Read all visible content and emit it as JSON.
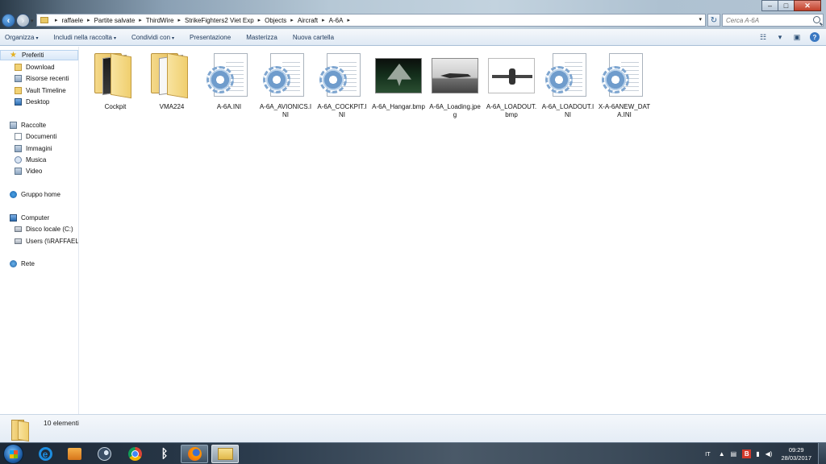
{
  "window": {
    "controls": {
      "minimize": "–",
      "maximize": "□",
      "close": "✕"
    }
  },
  "address_bar": {
    "breadcrumbs": [
      "raffaele",
      "Partite salvate",
      "ThirdWire",
      "StrikeFighters2 Viet Exp",
      "Objects",
      "Aircraft",
      "A-6A"
    ]
  },
  "search": {
    "placeholder": "Cerca A-6A"
  },
  "toolbar": {
    "items": [
      {
        "label": "Organizza",
        "has_menu": true
      },
      {
        "label": "Includi nella raccolta",
        "has_menu": true
      },
      {
        "label": "Condividi con",
        "has_menu": true
      },
      {
        "label": "Presentazione",
        "has_menu": false
      },
      {
        "label": "Masterizza",
        "has_menu": false
      },
      {
        "label": "Nuova cartella",
        "has_menu": false
      }
    ],
    "view_icon": "view-options-icon",
    "preview_icon": "preview-pane-icon",
    "help_icon": "help-icon"
  },
  "sidebar": {
    "groups": [
      {
        "label": "Preferiti",
        "icon": "star-icon",
        "items": [
          {
            "label": "Download",
            "icon": "download-folder-icon"
          },
          {
            "label": "Risorse recenti",
            "icon": "recent-places-icon"
          },
          {
            "label": "Vault Timeline",
            "icon": "folder-icon"
          },
          {
            "label": "Desktop",
            "icon": "desktop-icon"
          }
        ]
      },
      {
        "label": "Raccolte",
        "icon": "libraries-icon",
        "items": [
          {
            "label": "Documenti",
            "icon": "documents-icon"
          },
          {
            "label": "Immagini",
            "icon": "pictures-icon"
          },
          {
            "label": "Musica",
            "icon": "music-icon"
          },
          {
            "label": "Video",
            "icon": "video-icon"
          }
        ]
      },
      {
        "label": "Gruppo home",
        "icon": "homegroup-icon",
        "items": []
      },
      {
        "label": "Computer",
        "icon": "computer-icon",
        "items": [
          {
            "label": "Disco locale (C:)",
            "icon": "drive-icon"
          },
          {
            "label": "Users (\\\\RAFFAELE",
            "icon": "network-drive-icon"
          }
        ]
      },
      {
        "label": "Rete",
        "icon": "network-icon",
        "items": []
      }
    ]
  },
  "files": [
    {
      "name": "Cockpit",
      "type": "folder",
      "icon": "folder-icon",
      "variant": "dark"
    },
    {
      "name": "VMA224",
      "type": "folder",
      "icon": "folder-icon",
      "variant": "light"
    },
    {
      "name": "A-6A.INI",
      "type": "ini",
      "icon": "config-file-icon"
    },
    {
      "name": "A-6A_AVIONICS.INI",
      "type": "ini",
      "icon": "config-file-icon"
    },
    {
      "name": "A-6A_COCKPIT.INI",
      "type": "ini",
      "icon": "config-file-icon"
    },
    {
      "name": "A-6A_Hangar.bmp",
      "type": "image",
      "icon": "image-thumbnail",
      "variant": "hangar"
    },
    {
      "name": "A-6A_Loading.jpeg",
      "type": "image",
      "icon": "image-thumbnail",
      "variant": "loading"
    },
    {
      "name": "A-6A_LOADOUT.bmp",
      "type": "image",
      "icon": "image-thumbnail",
      "variant": "loadout"
    },
    {
      "name": "A-6A_LOADOUT.INI",
      "type": "ini",
      "icon": "config-file-icon"
    },
    {
      "name": "X-A-6ANEW_DATA.INI",
      "type": "ini",
      "icon": "config-file-icon"
    }
  ],
  "status": {
    "count_text": "10 elementi"
  },
  "taskbar": {
    "apps": [
      {
        "name": "Internet Explorer",
        "icon": "ie-icon"
      },
      {
        "name": "Windows Media Player",
        "icon": "media-player-icon"
      },
      {
        "name": "Steam",
        "icon": "steam-icon"
      },
      {
        "name": "Google Chrome",
        "icon": "chrome-icon"
      },
      {
        "name": "Bluetooth",
        "icon": "bluetooth-icon"
      },
      {
        "name": "Firefox",
        "icon": "firefox-icon"
      },
      {
        "name": "Esplora risorse",
        "icon": "explorer-icon"
      }
    ],
    "tray": {
      "language": "IT",
      "time": "09:29",
      "date": "28/03/2017"
    }
  }
}
